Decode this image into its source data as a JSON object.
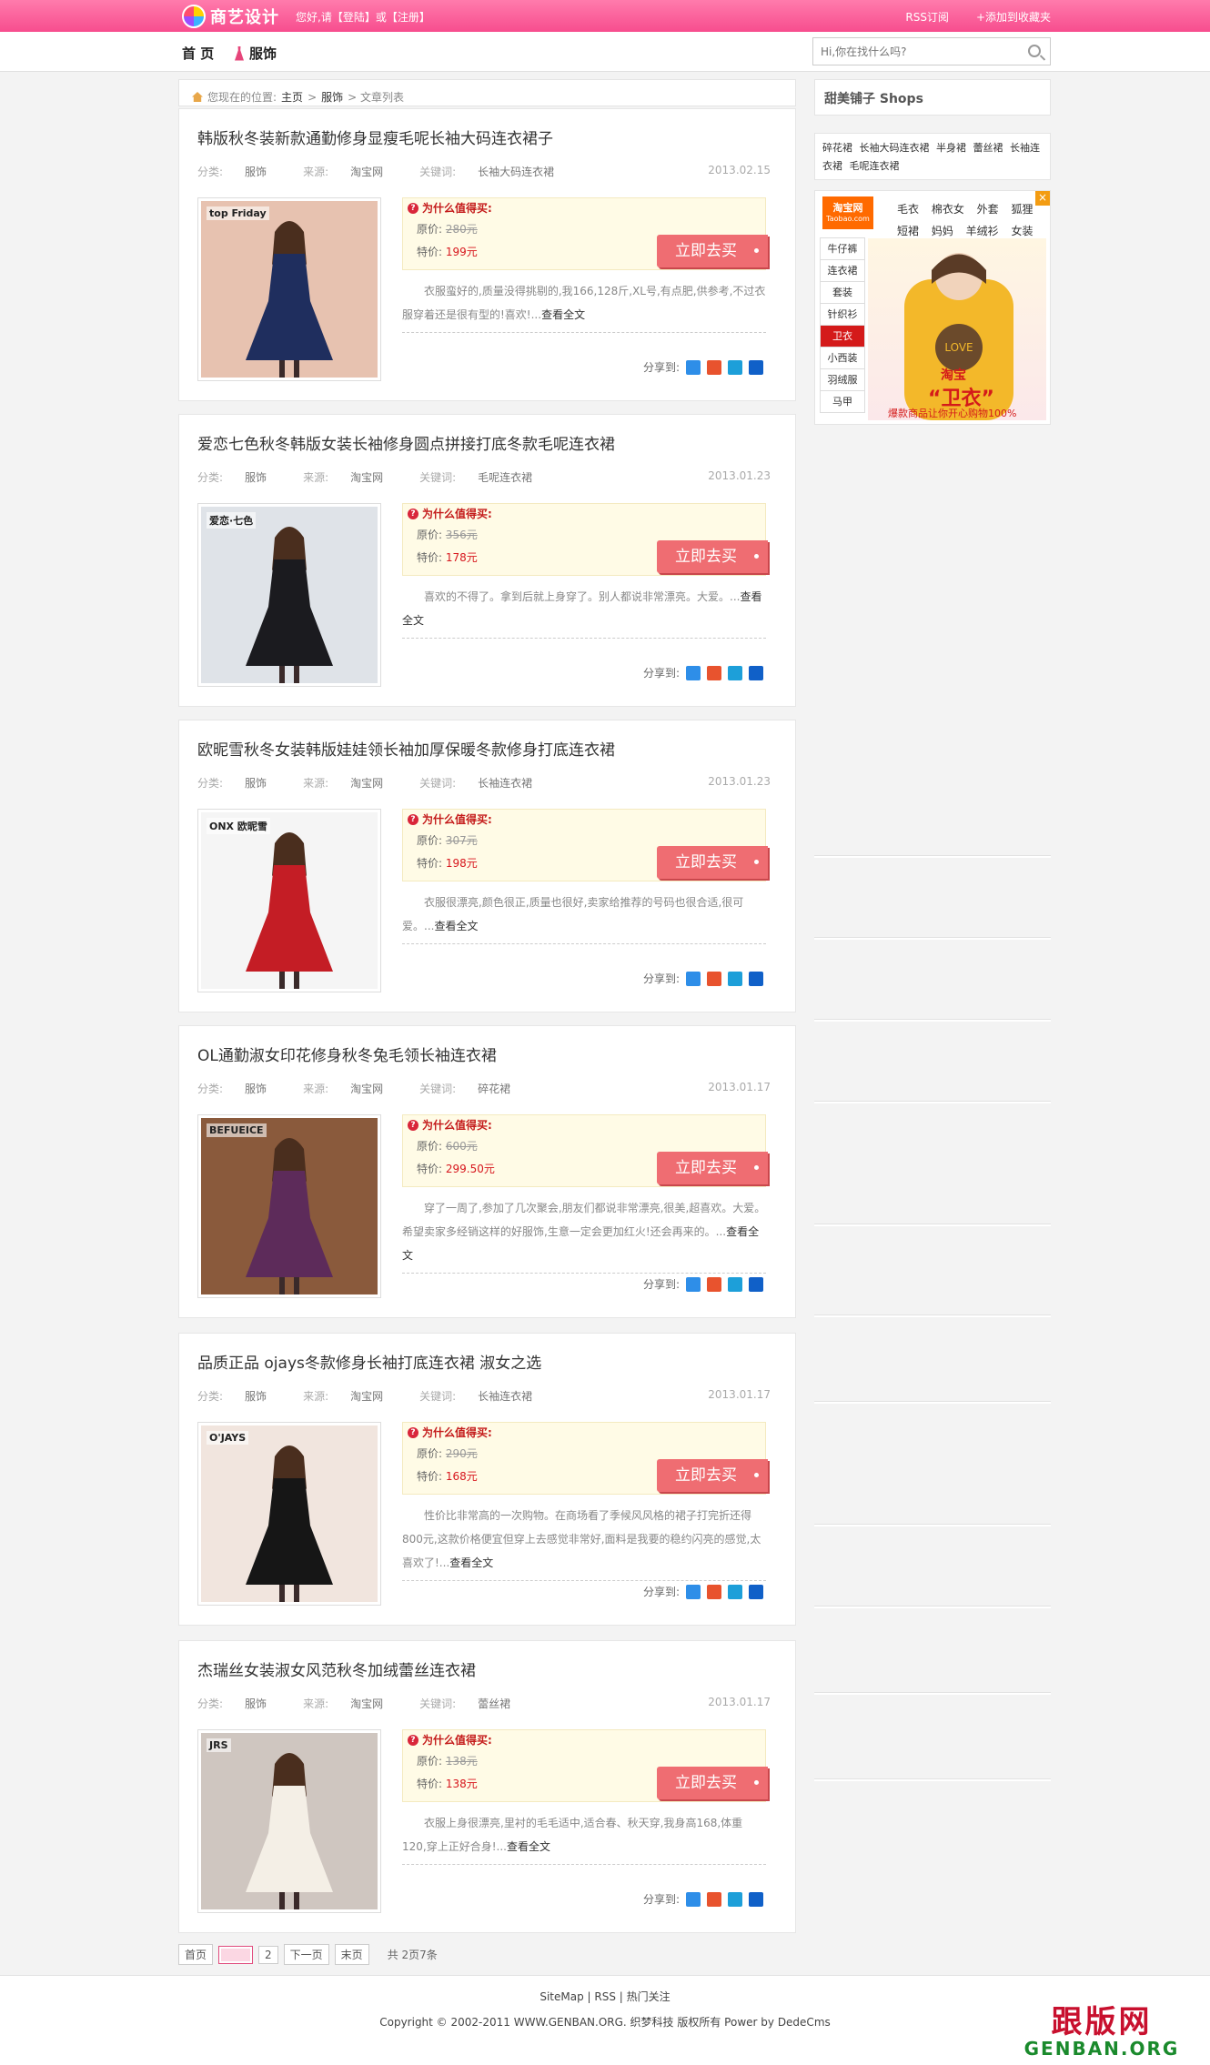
{
  "header": {
    "logo_text": "商艺设计",
    "welcome": "您好,请【登陆】或【注册】",
    "rss": "RSS订阅",
    "favorite": "+添加到收藏夹"
  },
  "nav": {
    "home": "首 页",
    "category": "服饰"
  },
  "search": {
    "placeholder": "Hi,你在找什么吗?"
  },
  "breadcrumb": {
    "prefix": "您现在的位置:",
    "home": "主页",
    "category": "服饰",
    "current": "> 文章列表"
  },
  "labels": {
    "category": "分类:",
    "source": "来源:",
    "keywords": "关键词:",
    "why": "为什么值得买:",
    "original": "原价:",
    "special": "特价:",
    "buy": "立即去买",
    "share": "分享到:",
    "more": "查看全文"
  },
  "articles": [
    {
      "title": "韩版秋冬装新款通勤修身显瘦毛呢长袖大码连衣裙子",
      "category": "服饰",
      "source": "淘宝网",
      "keywords": "长袖大码连衣裙",
      "date": "2013.02.15",
      "original_price": "280元",
      "special_price": "199元",
      "desc": "衣服蛮好的,质量没得挑剔的,我166,128斤,XL号,有点肥,供参考,不过衣服穿着还是很有型的!喜欢!...",
      "thumb_brand": "top Friday",
      "colors": {
        "bg": "#e7c2b0",
        "dress": "#1f2e5e"
      }
    },
    {
      "title": "爱恋七色秋冬韩版女装长袖修身圆点拼接打底冬款毛呢连衣裙",
      "category": "服饰",
      "source": "淘宝网",
      "keywords": "毛呢连衣裙",
      "date": "2013.01.23",
      "original_price": "356元",
      "special_price": "178元",
      "desc": "喜欢的不得了。拿到后就上身穿了。别人都说非常漂亮。大爱。...",
      "thumb_brand": "爱恋·七色",
      "colors": {
        "bg": "#dfe3e8",
        "dress": "#1b1b1f"
      }
    },
    {
      "title": "欧昵雪秋冬女装韩版娃娃领长袖加厚保暖冬款修身打底连衣裙",
      "category": "服饰",
      "source": "淘宝网",
      "keywords": "长袖连衣裙",
      "date": "2013.01.23",
      "original_price": "307元",
      "special_price": "198元",
      "desc": "衣服很漂亮,颜色很正,质量也很好,卖家给推荐的号码也很合适,很可爱。...",
      "thumb_brand": "ONX 欧昵雪",
      "colors": {
        "bg": "#f5f5f5",
        "dress": "#c41d25"
      }
    },
    {
      "title": "OL通勤淑女印花修身秋冬兔毛领长袖连衣裙",
      "category": "服饰",
      "source": "淘宝网",
      "keywords": "碎花裙",
      "date": "2013.01.17",
      "original_price": "600元",
      "special_price": "299.50元",
      "desc": "穿了一周了,参加了几次聚会,朋友们都说非常漂亮,很美,超喜欢。大爱。希望卖家多经销这样的好服饰,生意一定会更加红火!还会再来的。...",
      "thumb_brand": "BEFUEICE",
      "colors": {
        "bg": "#8a5a3c",
        "dress": "#5d2b5a"
      }
    },
    {
      "title": "品质正品 ojays冬款修身长袖打底连衣裙 淑女之选",
      "category": "服饰",
      "source": "淘宝网",
      "keywords": "长袖连衣裙",
      "date": "2013.01.17",
      "original_price": "290元",
      "special_price": "168元",
      "desc": "性价比非常高的一次购物。在商场看了季候风风格的裙子打完折还得800元,这款价格便宜但穿上去感觉非常好,面料是我要的稳约闪亮的感觉,太喜欢了!...",
      "thumb_brand": "O'JAYS",
      "colors": {
        "bg": "#f1e5de",
        "dress": "#161616"
      }
    },
    {
      "title": "杰瑞丝女装淑女风范秋冬加绒蕾丝连衣裙",
      "category": "服饰",
      "source": "淘宝网",
      "keywords": "蕾丝裙",
      "date": "2013.01.17",
      "original_price": "138元",
      "special_price": "138元",
      "desc": "衣服上身很漂亮,里衬的毛毛适中,适合春、秋天穿,我身高168,体重120,穿上正好合身!...",
      "thumb_brand": "JRS",
      "colors": {
        "bg": "#cfc6c0",
        "dress": "#f4efe6"
      }
    }
  ],
  "pager": {
    "first": "首页",
    "page2": "2",
    "next": "下一页",
    "last": "末页",
    "total": "共 2页7条"
  },
  "sidebar": {
    "shops_title": "甜美铺子 Shops",
    "tags": "碎花裙 长袖大码连衣裙 半身裙 蕾丝裙 长袖连衣裙 毛呢连衣裙",
    "ad": {
      "logo": "淘宝网",
      "logo_sub": "Taobao.com",
      "close": "×",
      "top_links": "毛衣 棉衣女 外套 狐狸 短裙 妈妈 羊绒衫 女装",
      "menu": [
        "牛仔裤",
        "连衣裙",
        "套装",
        "针织衫",
        "卫衣",
        "小西装",
        "羽绒服",
        "马甲"
      ],
      "active_index": 4,
      "banner_title": "淘宝",
      "banner_big": "“卫衣”",
      "bottom": "爆款商品让你开心购物100%"
    }
  },
  "footer": {
    "links": "SiteMap | RSS | 热门关注",
    "copyright": "Copyright © 2002-2011 WWW.GENBAN.ORG. 织梦科技 版权所有 Power by DedeCms"
  },
  "watermark": {
    "cn": "跟版网",
    "en": "GENBAN.ORG"
  }
}
